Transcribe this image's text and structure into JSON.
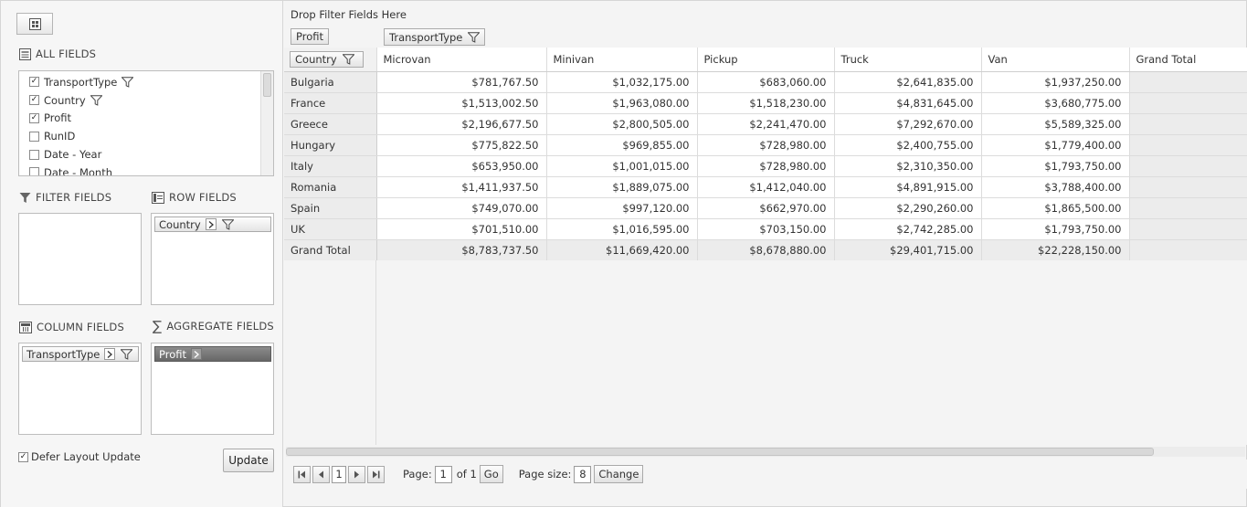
{
  "left": {
    "all_fields_title": "ALL FIELDS",
    "fields": [
      {
        "label": "TransportType",
        "checked": true,
        "filter": true
      },
      {
        "label": "Country",
        "checked": true,
        "filter": true
      },
      {
        "label": "Profit",
        "checked": true,
        "filter": false
      },
      {
        "label": "RunID",
        "checked": false,
        "filter": false
      },
      {
        "label": "Date - Year",
        "checked": false,
        "filter": false
      },
      {
        "label": "Date - Month",
        "checked": false,
        "filter": false
      }
    ],
    "filter_fields_title": "FILTER FIELDS",
    "row_fields_title": "ROW FIELDS",
    "column_fields_title": "COLUMN FIELDS",
    "aggregate_fields_title": "AGGREGATE FIELDS",
    "row_field_chip": "Country",
    "column_field_chip": "TransportType",
    "aggregate_field_chip": "Profit",
    "defer_label": "Defer Layout Update",
    "defer_checked": true,
    "update_label": "Update"
  },
  "grid": {
    "drop_filter_label": "Drop Filter Fields Here",
    "aggregate_chip": "Profit",
    "column_chip": "TransportType",
    "row_chip": "Country",
    "columns": [
      "Microvan",
      "Minivan",
      "Pickup",
      "Truck",
      "Van",
      "Grand Total"
    ],
    "rows": [
      {
        "label": "Bulgaria",
        "values": [
          "$781,767.50",
          "$1,032,175.00",
          "$683,060.00",
          "$2,641,835.00",
          "$1,937,250.00",
          ""
        ]
      },
      {
        "label": "France",
        "values": [
          "$1,513,002.50",
          "$1,963,080.00",
          "$1,518,230.00",
          "$4,831,645.00",
          "$3,680,775.00",
          ""
        ]
      },
      {
        "label": "Greece",
        "values": [
          "$2,196,677.50",
          "$2,800,505.00",
          "$2,241,470.00",
          "$7,292,670.00",
          "$5,589,325.00",
          ""
        ]
      },
      {
        "label": "Hungary",
        "values": [
          "$775,822.50",
          "$969,855.00",
          "$728,980.00",
          "$2,400,755.00",
          "$1,779,400.00",
          ""
        ]
      },
      {
        "label": "Italy",
        "values": [
          "$653,950.00",
          "$1,001,015.00",
          "$728,980.00",
          "$2,310,350.00",
          "$1,793,750.00",
          ""
        ]
      },
      {
        "label": "Romania",
        "values": [
          "$1,411,937.50",
          "$1,889,075.00",
          "$1,412,040.00",
          "$4,891,915.00",
          "$3,788,400.00",
          ""
        ]
      },
      {
        "label": "Spain",
        "values": [
          "$749,070.00",
          "$997,120.00",
          "$662,970.00",
          "$2,290,260.00",
          "$1,865,500.00",
          ""
        ]
      },
      {
        "label": "UK",
        "values": [
          "$701,510.00",
          "$1,016,595.00",
          "$703,150.00",
          "$2,742,285.00",
          "$1,793,750.00",
          ""
        ]
      }
    ],
    "total": {
      "label": "Grand Total",
      "values": [
        "$8,783,737.50",
        "$11,669,420.00",
        "$8,678,880.00",
        "$29,401,715.00",
        "$22,228,150.00",
        ""
      ]
    }
  },
  "pager": {
    "page_label": "Page:",
    "page_value": "1",
    "of_label": "of 1",
    "go_label": "Go",
    "page_size_label": "Page size:",
    "page_size_value": "8",
    "change_label": "Change"
  }
}
